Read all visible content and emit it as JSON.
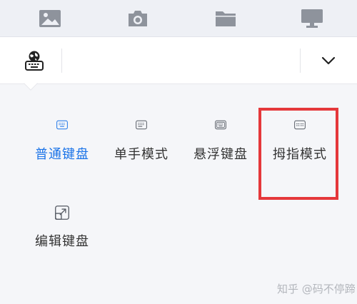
{
  "colors": {
    "accent": "#1a73e8",
    "icon_gray": "#555a63",
    "tray_icon": "#8e939c",
    "highlight": "#e5383b"
  },
  "top_tray": {
    "icons": [
      "image-icon",
      "camera-icon",
      "folder-icon",
      "monitor-icon"
    ]
  },
  "toolbar": {
    "language_icon": "globe-keyboard-icon",
    "collapse_icon": "chevron-down-icon"
  },
  "keyboard_modes": [
    {
      "label": "普通键盘",
      "icon": "keyboard-icon",
      "active": true
    },
    {
      "label": "单手模式",
      "icon": "one-hand-keyboard-icon",
      "active": false
    },
    {
      "label": "悬浮键盘",
      "icon": "floating-keyboard-icon",
      "active": false
    },
    {
      "label": "拇指模式",
      "icon": "thumb-keyboard-icon",
      "active": false
    },
    {
      "label": "编辑键盘",
      "icon": "edit-keyboard-icon",
      "active": false
    }
  ],
  "watermark": "知乎 @码不停蹄"
}
